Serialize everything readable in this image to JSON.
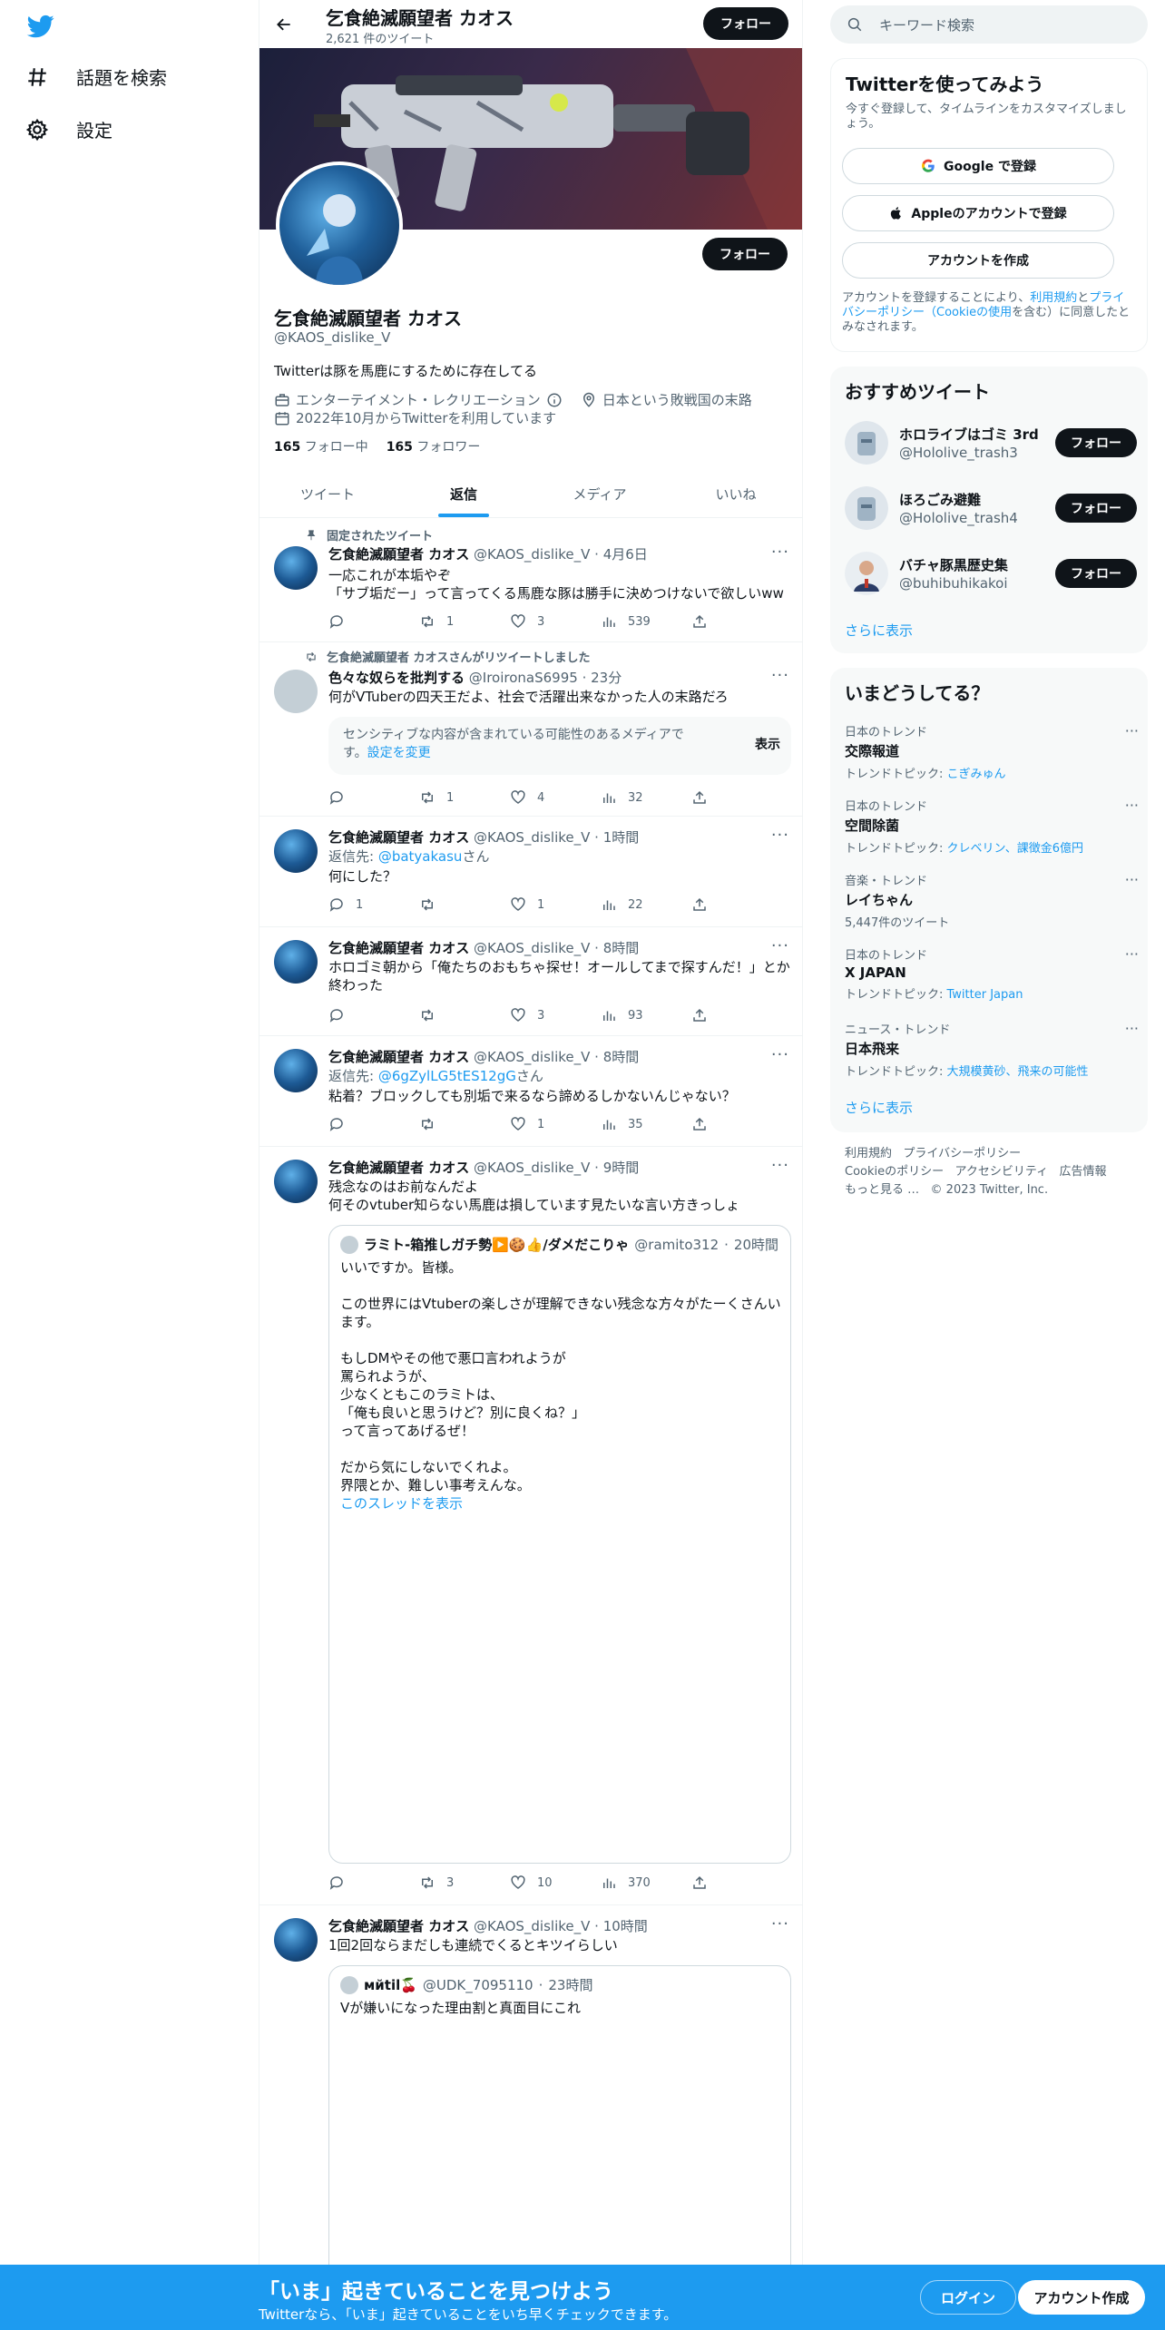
{
  "nav": {
    "explore_label": "話題を検索",
    "settings_label": "設定"
  },
  "header": {
    "name": "乞食絶滅願望者 カオス",
    "tweet_count": "2,621 件のツイート",
    "follow_label": "フォロー"
  },
  "profile": {
    "name": "乞食絶滅願望者 カオス",
    "handle": "@KAOS_dislike_V",
    "bio": "Twitterは豚を馬鹿にするために存在してる",
    "category": "エンターテイメント・レクリエーション",
    "location": "日本という敗戦国の末路",
    "joined": "2022年10月からTwitterを利用しています",
    "following_count": "165",
    "following_label": "フォロー中",
    "followers_count": "165",
    "followers_label": "フォロワー",
    "follow_label": "フォロー"
  },
  "tabs": [
    {
      "label": "ツイート",
      "active": false
    },
    {
      "label": "返信",
      "active": true
    },
    {
      "label": "メディア",
      "active": false
    },
    {
      "label": "いいね",
      "active": false
    }
  ],
  "tweets": [
    {
      "context": "固定されたツイート",
      "name": "乞食絶滅願望者 カオス",
      "handle": "@KAOS_dislike_V",
      "time": "4月6日",
      "text": "一応これが本垢やぞ\n「サブ垢だー」って言ってくる馬鹿な豚は勝手に決めつけないで欲しいww",
      "replies": "",
      "retweets": "1",
      "likes": "3",
      "views": "539"
    },
    {
      "context": "乞食絶滅願望者 カオスさんがリツイートしました",
      "name": "色々な奴らを批判する",
      "handle": "@IroironaS6995",
      "time": "23分",
      "text": "何がVTuberの四天王だよ、社会で活躍出来なかった人の末路だろ",
      "sensitive_text": "センシティブな内容が含まれている可能性のあるメディアです。",
      "sensitive_link": "設定を変更",
      "sensitive_show": "表示",
      "replies": "",
      "retweets": "1",
      "likes": "4",
      "views": "32"
    },
    {
      "name": "乞食絶滅願望者 カオス",
      "handle": "@KAOS_dislike_V",
      "time": "1時間",
      "reply_prefix": "返信先: ",
      "reply_to": "@batyakasu",
      "reply_suffix": "さん",
      "text": "何にした？",
      "replies": "1",
      "retweets": "",
      "likes": "1",
      "views": "22"
    },
    {
      "name": "乞食絶滅願望者 カオス",
      "handle": "@KAOS_dislike_V",
      "time": "8時間",
      "text": "ホロゴミ朝から「俺たちのおもちゃ探せ！オールしてまで探すんだ！」とか終わった",
      "replies": "",
      "retweets": "",
      "likes": "3",
      "views": "93"
    },
    {
      "name": "乞食絶滅願望者 カオス",
      "handle": "@KAOS_dislike_V",
      "time": "8時間",
      "reply_prefix": "返信先: ",
      "reply_to": "@6gZylLG5tES12gG",
      "reply_suffix": "さん",
      "text": "粘着？ブロックしても別垢で来るなら諦めるしかないんじゃない？",
      "replies": "",
      "retweets": "",
      "likes": "1",
      "views": "35"
    },
    {
      "name": "乞食絶滅願望者 カオス",
      "handle": "@KAOS_dislike_V",
      "time": "9時間",
      "text": "残念なのはお前なんだよ\n何そのvtuber知らない馬鹿は損しています見たいな言い方きっしょ",
      "quote_name": "ラミト-箱推しガチ勢▶️🍪👍/ダメだこりゃ",
      "quote_handle": "@ramito312",
      "quote_time": "20時間",
      "quote_text": "いいですか。皆様。\n\nこの世界にはVtuberの楽しさが理解できない残念な方々がたーくさんいます。\n\nもしDMやその他で悪口言われようが\n罵られようが、\n少なくともこのラミトは、\n「俺も良いと思うけど？別に良くね？」\nって言ってあげるぜ！\n\nだから気にしないでくれよ。\n界隈とか、難しい事考えんな。",
      "quote_link": "このスレッドを表示",
      "replies": "",
      "retweets": "3",
      "likes": "10",
      "views": "370"
    },
    {
      "name": "乞食絶滅願望者 カオス",
      "handle": "@KAOS_dislike_V",
      "time": "10時間",
      "text": "1回2回ならまだしも連続でくるとキツイらしい",
      "quote_name": "мйtil🍒",
      "quote_handle": "@UDK_7095110",
      "quote_time": "23時間",
      "quote_text": "Vが嫌いになった理由割と真面目にこれ"
    }
  ],
  "search": {
    "placeholder": "キーワード検索"
  },
  "signup_panel": {
    "title": "Twitterを使ってみよう",
    "subtitle": "今すぐ登録して、タイムラインをカスタマイズしましょう。",
    "google": "Google で登録",
    "apple": "Appleのアカウントで登録",
    "create": "アカウントを作成",
    "terms_pre": "アカウントを登録することにより、",
    "terms_link1": "利用規約",
    "terms_mid": "と",
    "terms_link2": "プライバシーポリシー（Cookieの使用",
    "terms_post": "を含む）に同意したとみなされます。"
  },
  "who_to_follow": {
    "title": "おすすめツイート",
    "items": [
      {
        "name": "ホロライブはゴミ 3rd",
        "handle": "@Hololive_trash3",
        "follow": "フォロー"
      },
      {
        "name": "ほろごみ避難",
        "handle": "@Hololive_trash4",
        "follow": "フォロー"
      },
      {
        "name": "バチャ豚黒歴史集",
        "handle": "@buhibuhikakoi",
        "follow": "フォロー"
      }
    ],
    "show_more": "さらに表示"
  },
  "trends": {
    "title": "いまどうしてる？",
    "items": [
      {
        "category": "日本のトレンド",
        "name": "交際報道",
        "sub_prefix": "トレンドトピック: ",
        "sub_link": "こぎみゅん"
      },
      {
        "category": "日本のトレンド",
        "name": "空間除菌",
        "sub_prefix": "トレンドトピック: ",
        "sub_link": "クレベリン、課徴金6億円"
      },
      {
        "category": "音楽・トレンド",
        "name": "レイちゃん",
        "sub_prefix": "5,447件のツイート",
        "sub_link": ""
      },
      {
        "category": "日本のトレンド",
        "name": "X JAPAN",
        "sub_prefix": "トレンドトピック: ",
        "sub_link": "Twitter Japan"
      },
      {
        "category": "ニュース・トレンド",
        "name": "日本飛来",
        "sub_prefix": "トレンドトピック: ",
        "sub_link": "大規模黄砂、飛来の可能性"
      }
    ],
    "show_more": "さらに表示"
  },
  "footer": {
    "terms": "利用規約",
    "privacy": "プライバシーポリシー",
    "cookie": "Cookieのポリシー",
    "accessibility": "アクセシビリティ",
    "ads": "広告情報",
    "more": "もっと見る …",
    "copyright": "© 2023 Twitter, Inc."
  },
  "bottom_bar": {
    "title": "「いま」起きていることを見つけよう",
    "subtitle": "Twitterなら、「いま」起きていることをいち早くチェックできます。",
    "login": "ログイン",
    "signup": "アカウント作成"
  },
  "colors": {
    "accent": "#1d9bf0",
    "text": "#0f1419",
    "muted": "#536471"
  }
}
